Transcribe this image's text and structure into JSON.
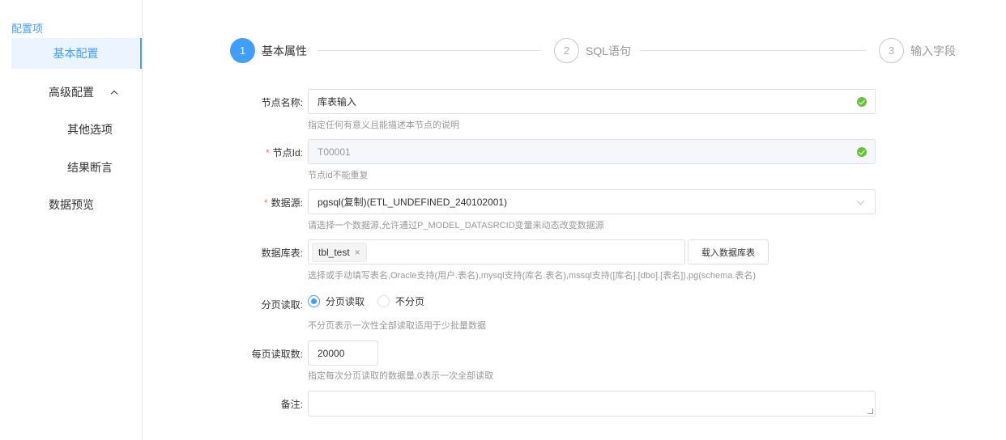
{
  "sidebar": {
    "title": "配置项",
    "items": {
      "basic": "基本配置",
      "advanced": "高级配置",
      "other_options": "其他选项",
      "result_assert": "结果断言",
      "preview": "数据预览"
    }
  },
  "steps": [
    {
      "num": "1",
      "label": "基本属性",
      "state": "active"
    },
    {
      "num": "2",
      "label": "SQL语句",
      "state": "idle"
    },
    {
      "num": "3",
      "label": "输入字段",
      "state": "idle"
    }
  ],
  "form": {
    "node_name": {
      "label": "节点名称:",
      "value": "库表输入",
      "hint": "指定任何有意义且能描述本节点的说明"
    },
    "node_id": {
      "label": "节点Id:",
      "value": "T00001",
      "hint": "节点id不能重复"
    },
    "datasource": {
      "label": "数据源:",
      "value": "pgsql(复制)(ETL_UNDEFINED_240102001)",
      "hint": "请选择一个数据源,允许通过P_MODEL_DATASRCID变量来动态改变数据源"
    },
    "db_table": {
      "label": "数据库表:",
      "tag": "tbl_test",
      "tag_close": "×",
      "button": "载入数据库表",
      "hint": "选择或手动填写表名,Oracle支持(用户.表名),mysql支持(库名.表名),mssql支持([库名].[dbo].[表名]),pg(schema.表名)"
    },
    "paging": {
      "label": "分页读取:",
      "option_on": "分页读取",
      "option_off": "不分页",
      "hint": "不分页表示一次性全部读取适用于少批量数据"
    },
    "page_size": {
      "label": "每页读取数:",
      "value": "20000",
      "hint": "指定每次分页读取的数据量,0表示一次全部读取"
    },
    "remark": {
      "label": "备注:",
      "value": ""
    }
  },
  "colors": {
    "accent": "#409eff",
    "success": "#67c23a",
    "required": "#f56c6c"
  }
}
